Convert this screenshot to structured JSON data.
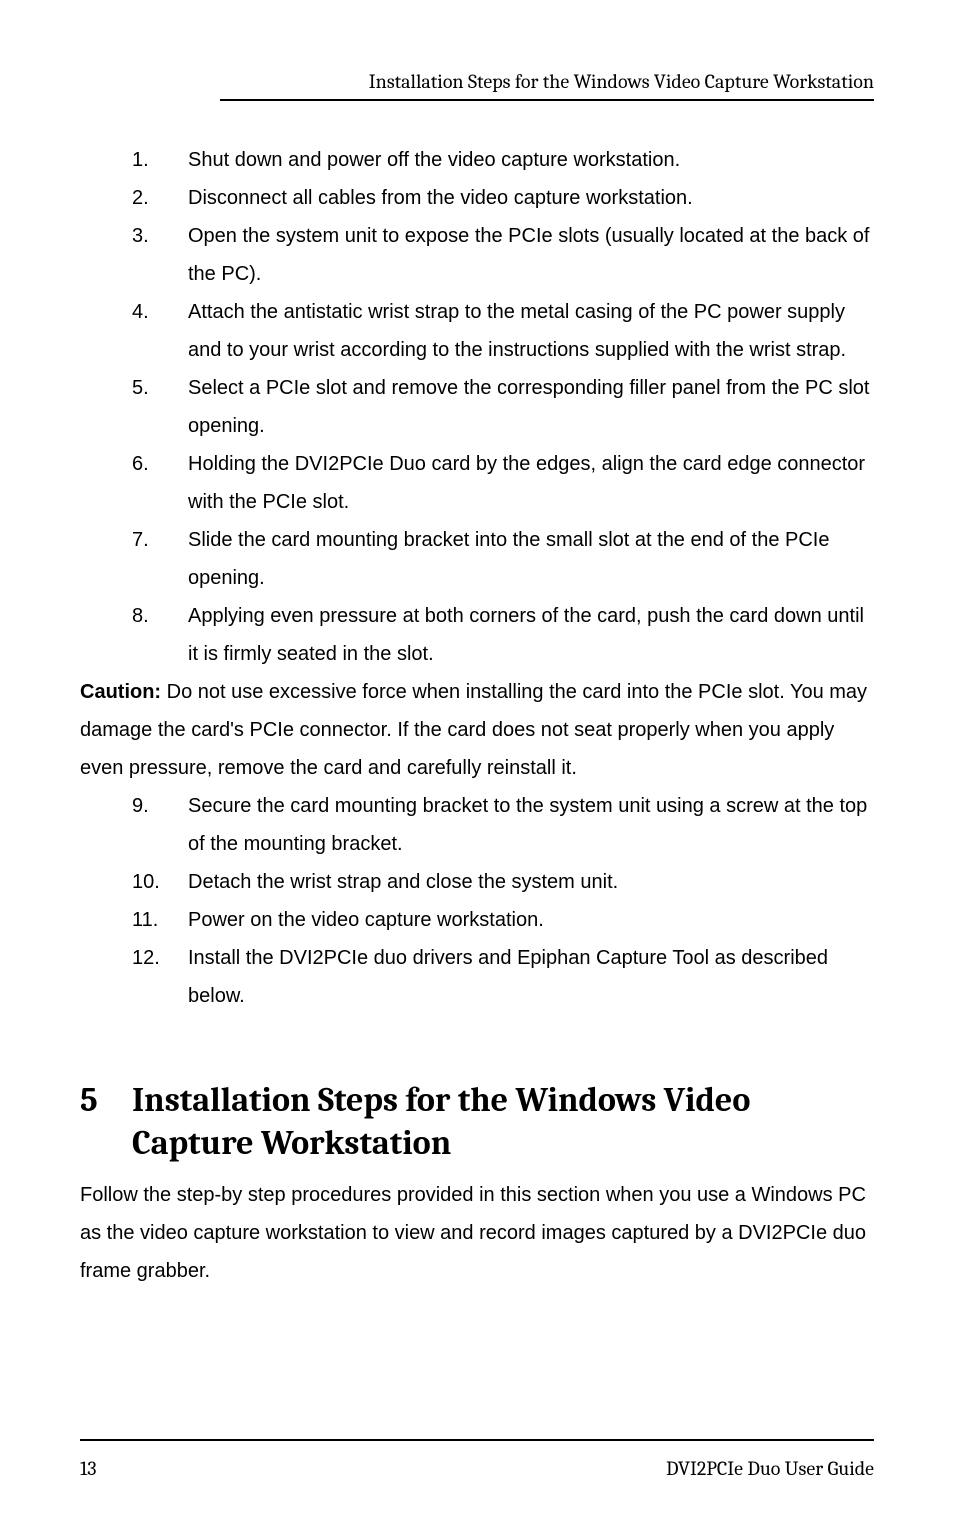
{
  "header": {
    "running_title": "Installation Steps for the Windows Video Capture Workstation"
  },
  "steps_a": [
    "Shut down and power off the video capture workstation.",
    "Disconnect all cables from the video capture workstation.",
    "Open the system unit to expose the PCIe slots (usually located at the back of the PC).",
    "Attach the antistatic wrist strap to the metal casing of the PC power supply and to your wrist according to the instructions supplied with the wrist strap.",
    "Select a PCIe slot and remove the corresponding filler panel from the PC slot opening.",
    "Holding the DVI2PCIe Duo card by the edges, align the card edge connector with the PCIe slot.",
    "Slide the card mounting bracket into the small slot at the end of the PCIe opening.",
    "Applying even pressure at both corners of the card, push the card down until it is firmly seated in the slot."
  ],
  "caution": {
    "label": "Caution:",
    "text": " Do not use excessive force when installing the card into the PCIe slot. You may damage the card's PCIe connector. If the card does not seat properly when you apply even pressure, remove the card and carefully reinstall it."
  },
  "steps_b": [
    "Secure the card mounting bracket to the system unit using a screw at the top of the mounting bracket.",
    " Detach the wrist strap and close the system unit.",
    "Power on the video capture workstation.",
    " Install the DVI2PCIe duo drivers and Epiphan Capture Tool as described below."
  ],
  "section": {
    "number": "5",
    "title": "Installation Steps for the Windows Video Capture Workstation"
  },
  "intro": "Follow the step-by step procedures provided in this section when you use a Windows PC as the video capture workstation to view and record images captured by a DVI2PCIe duo frame grabber.",
  "footer": {
    "page": "13",
    "doc": "DVI2PCIe Duo User Guide"
  }
}
